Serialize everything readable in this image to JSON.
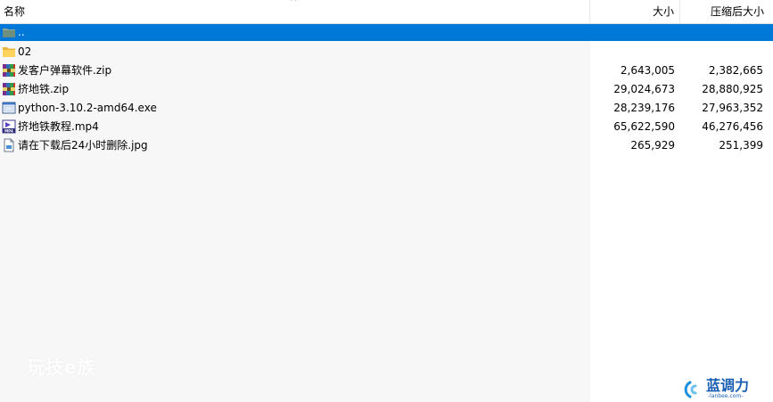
{
  "columns": {
    "name": "名称",
    "size": "大小",
    "packed": "压缩后大小",
    "sort_indicator": "^"
  },
  "files": [
    {
      "name": "..",
      "size": "",
      "packed": "",
      "icon": "folder-up-icon",
      "selected": true
    },
    {
      "name": "02",
      "size": "",
      "packed": "",
      "icon": "folder-icon",
      "selected": false
    },
    {
      "name": "发客户弹幕软件.zip",
      "size": "2,643,005",
      "packed": "2,382,665",
      "icon": "zip-archive-icon",
      "selected": false
    },
    {
      "name": "挤地铁.zip",
      "size": "29,024,673",
      "packed": "28,880,925",
      "icon": "zip-archive-icon",
      "selected": false
    },
    {
      "name": "python-3.10.2-amd64.exe",
      "size": "28,239,176",
      "packed": "27,963,352",
      "icon": "exe-icon",
      "selected": false
    },
    {
      "name": "挤地铁教程.mp4",
      "size": "65,622,590",
      "packed": "46,276,456",
      "icon": "mp4-icon",
      "selected": false
    },
    {
      "name": "请在下载后24小时删除.jpg",
      "size": "265,929",
      "packed": "251,399",
      "icon": "image-file-icon",
      "selected": false
    }
  ],
  "watermark_left": "玩技e族",
  "watermark_right": {
    "main": "蓝调力",
    "sub": "-lanbee.com-"
  },
  "colors": {
    "selection": "#0078d7",
    "header_border": "#e5e5e5",
    "sorted_column_bg": "#f7f7f7"
  }
}
